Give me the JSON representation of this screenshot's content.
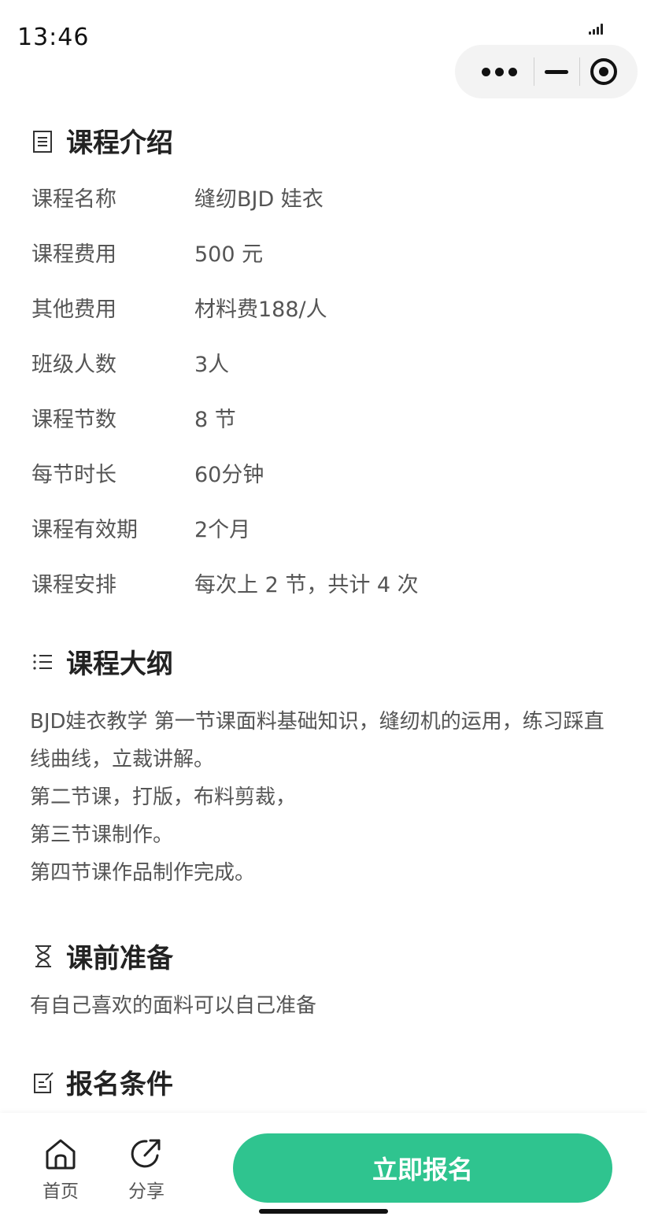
{
  "status_bar": {
    "time": "13:46"
  },
  "course_intro": {
    "title": "课程介绍",
    "rows": [
      {
        "label": "课程名称",
        "value": "缝纫BJD 娃衣"
      },
      {
        "label": "课程费用",
        "value": "500 元"
      },
      {
        "label": "其他费用",
        "value": "材料费188/人"
      },
      {
        "label": "班级人数",
        "value": "3人"
      },
      {
        "label": "课程节数",
        "value": "8 节"
      },
      {
        "label": "每节时长",
        "value": "60分钟"
      },
      {
        "label": "课程有效期",
        "value": "2个月"
      },
      {
        "label": "课程安排",
        "value": "每次上 2 节，共计 4 次"
      }
    ]
  },
  "outline": {
    "title": "课程大纲",
    "lines": [
      "BJD娃衣教学 第一节课面料基础知识，缝纫机的运用，练习踩直线曲线，立裁讲解。",
      "第二节课，打版，布料剪裁，",
      "第三节课制作。",
      "第四节课作品制作完成。"
    ]
  },
  "preparation": {
    "title": "课前准备",
    "text": "有自己喜欢的面料可以自己准备"
  },
  "requirements": {
    "title": "报名条件"
  },
  "bottom_bar": {
    "home_label": "首页",
    "share_label": "分享",
    "signup_label": "立即报名"
  },
  "colors": {
    "accent": "#2fc48f",
    "text": "#555555",
    "heading": "#222222"
  }
}
